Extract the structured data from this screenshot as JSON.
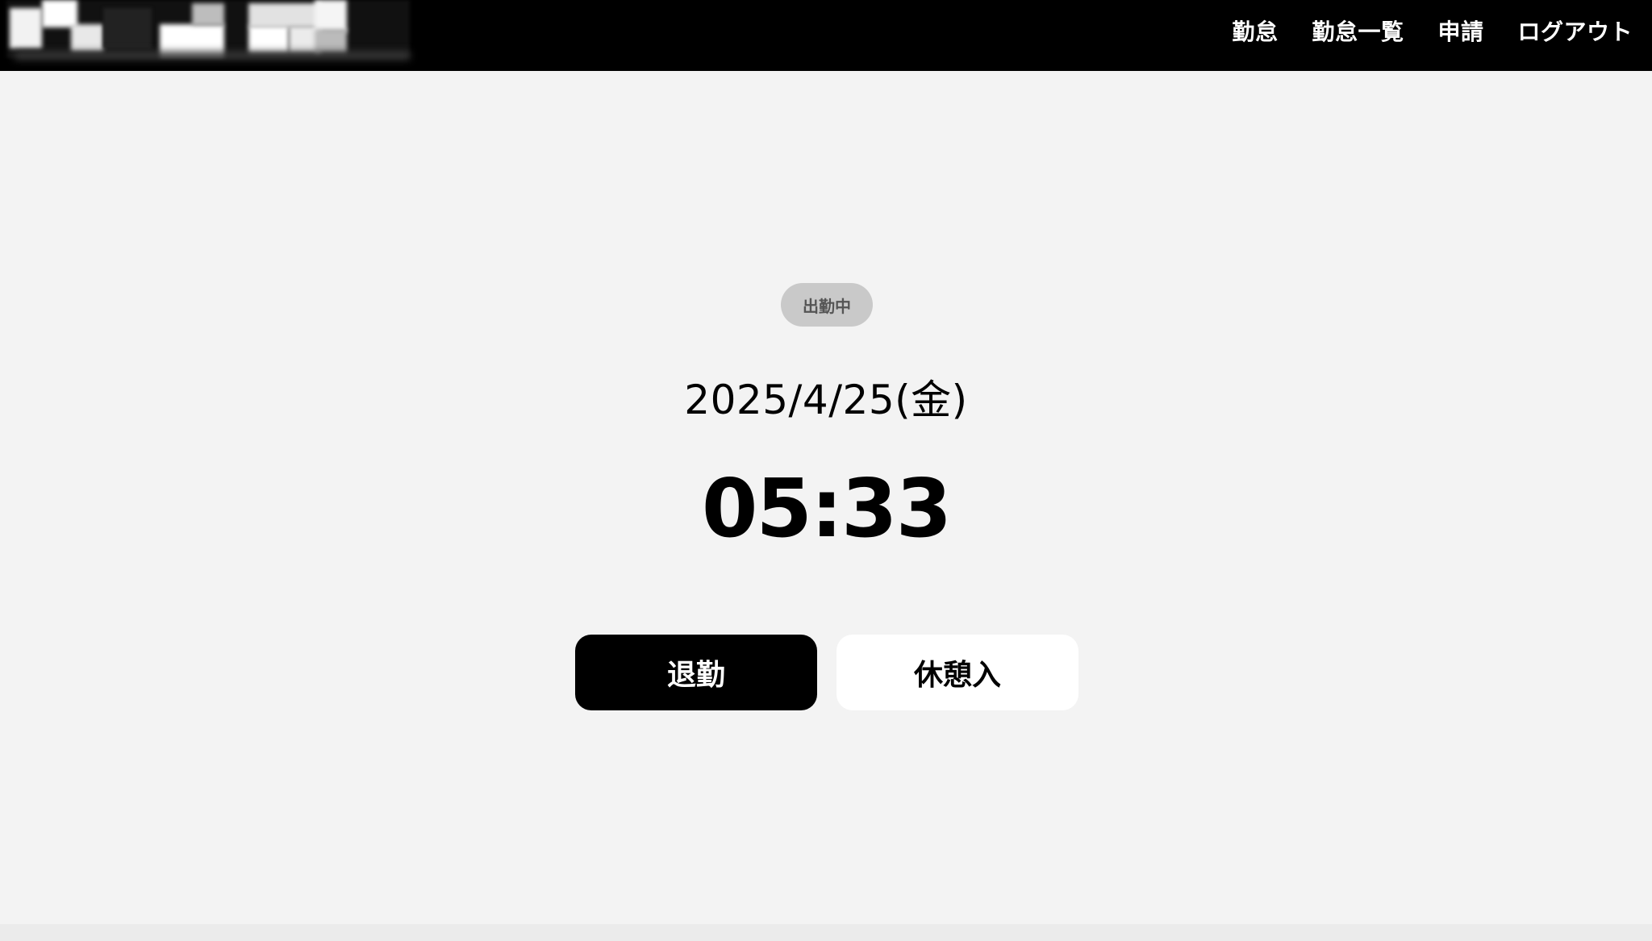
{
  "header": {
    "logo": "logo-image",
    "nav": [
      {
        "label": "勤怠"
      },
      {
        "label": "勤怠一覧"
      },
      {
        "label": "申請"
      },
      {
        "label": "ログアウト"
      }
    ]
  },
  "main": {
    "status_badge": "出勤中",
    "date": "2025/4/25(金)",
    "time": "05:33",
    "buttons": {
      "clock_out": "退勤",
      "break_in": "休憩入"
    }
  },
  "colors": {
    "header_bg": "#000000",
    "page_bg": "#f3f3f3",
    "badge_bg": "#c9c9c9",
    "primary_button": "#000000",
    "secondary_button": "#ffffff"
  }
}
